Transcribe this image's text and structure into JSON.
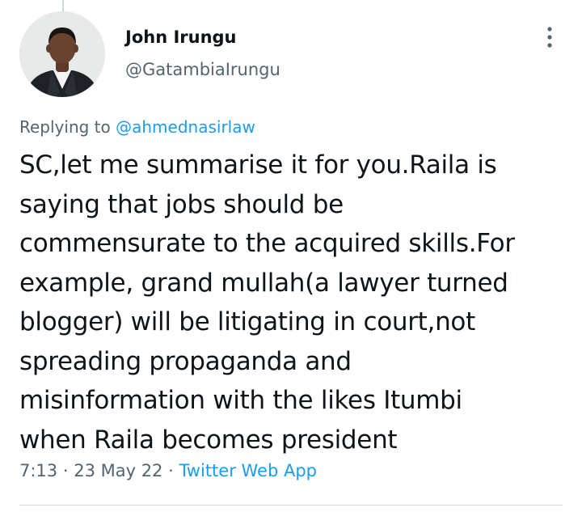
{
  "tweet": {
    "author": {
      "name": "John Irungu",
      "handle": "@GatambiaIrungu",
      "avatar_icon": "profile-photo"
    },
    "more_icon": "more-vertical-icon",
    "replying_prefix": "Replying to ",
    "replying_to": "@ahmednasirlaw",
    "text_lines": [
      "SC,let me summarise it for you.Raila is",
      "saying that jobs should be",
      "commensurate to the acquired skills.For",
      "example, grand mullah(a lawyer turned",
      "blogger) will be litigating in court,not",
      "spreading propaganda and",
      "misinformation with the likes Itumbi",
      "when Raila becomes president"
    ],
    "time": "7:13",
    "separator": " · ",
    "date": "23 May 22",
    "source": "Twitter Web App"
  },
  "colors": {
    "text_primary": "#0f1419",
    "text_secondary": "#536471",
    "link": "#1d9bf0",
    "divider": "#cfd9de"
  }
}
